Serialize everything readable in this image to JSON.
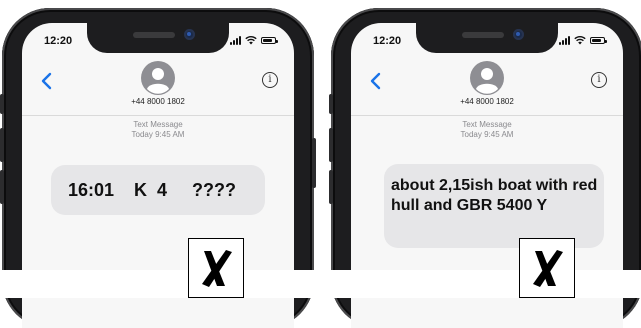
{
  "phones": [
    {
      "status_time": "12:20",
      "contact_number": "+44 8000 1802",
      "message_label": "Text Message",
      "message_time": "Today 9:45 AM",
      "message_text": "16:01    K  4     ????"
    },
    {
      "status_time": "12:20",
      "contact_number": "+44 8000 1802",
      "message_label": "Text Message",
      "message_time": "Today 9:45 AM",
      "message_text": "about 2,15ish boat with red hull and GBR 5400 Y"
    }
  ],
  "icons": {
    "back": "chevron-left-icon",
    "avatar": "person-avatar-icon",
    "info": "info-icon",
    "mark": "cross-mark-icon"
  },
  "colors": {
    "accent": "#1a73e8",
    "bubble": "#e6e6e8",
    "phone_body": "#1d1d1f"
  }
}
